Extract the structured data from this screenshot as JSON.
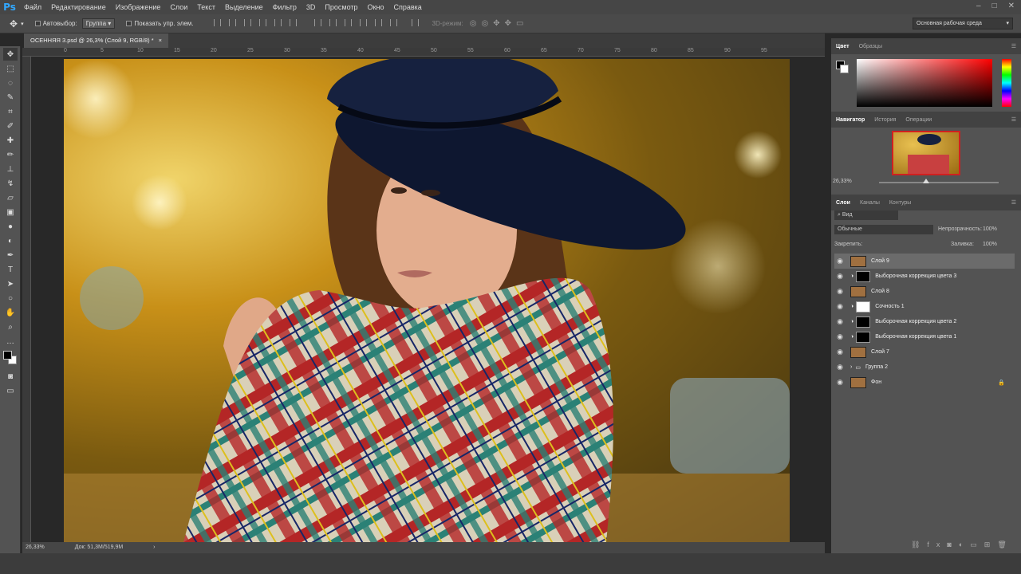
{
  "app": {
    "logo": "Ps"
  },
  "menu": {
    "items": [
      "Файл",
      "Редактирование",
      "Изображение",
      "Слои",
      "Текст",
      "Выделение",
      "Фильтр",
      "3D",
      "Просмотр",
      "Окно",
      "Справка"
    ]
  },
  "options": {
    "autoselect_label": "Автовыбор:",
    "autoselect_value": "Группа",
    "show_transform_label": "Показать упр. элем.",
    "mode_3d_label": "3D-режим:",
    "workspace": "Основная рабочая среда"
  },
  "document": {
    "tab_title": "ОСЕННЯЯ 3.psd @ 26,3% (Слой 9, RGB/8) *",
    "close_glyph": "×",
    "zoom": "26,33%",
    "doc_info": "Док: 51,3M/519,9M"
  },
  "ruler": {
    "top_ticks": [
      "0",
      "5",
      "10",
      "15",
      "20",
      "25",
      "30",
      "35",
      "40",
      "45",
      "50",
      "55",
      "60",
      "65",
      "70",
      "75",
      "80",
      "85",
      "90",
      "95"
    ]
  },
  "panels": {
    "color": {
      "tabs": [
        "Цвет",
        "Образцы"
      ]
    },
    "navigator": {
      "tabs": [
        "Навигатор",
        "История",
        "Операции"
      ],
      "zoom": "26,33%"
    },
    "layers": {
      "tabs": [
        "Слои",
        "Каналы",
        "Контуры"
      ],
      "filter_label": "Вид",
      "blend_mode": "Обычные",
      "opacity_label": "Непрозрачность:",
      "opacity_value": "100%",
      "lock_label": "Закрепить:",
      "fill_label": "Заливка:",
      "fill_value": "100%",
      "items": [
        {
          "name": "Слой 9"
        },
        {
          "name": "Выборочная коррекция цвета 3"
        },
        {
          "name": "Слой 8"
        },
        {
          "name": "Сочность 1"
        },
        {
          "name": "Выборочная коррекция цвета 2"
        },
        {
          "name": "Выборочная коррекция цвета 1"
        },
        {
          "name": "Слой 7"
        },
        {
          "name": "Группа 2"
        },
        {
          "name": "Фон"
        }
      ]
    }
  },
  "colors": {
    "accent": "#31a8ff",
    "foreground": "#000000",
    "background": "#ffffff"
  }
}
